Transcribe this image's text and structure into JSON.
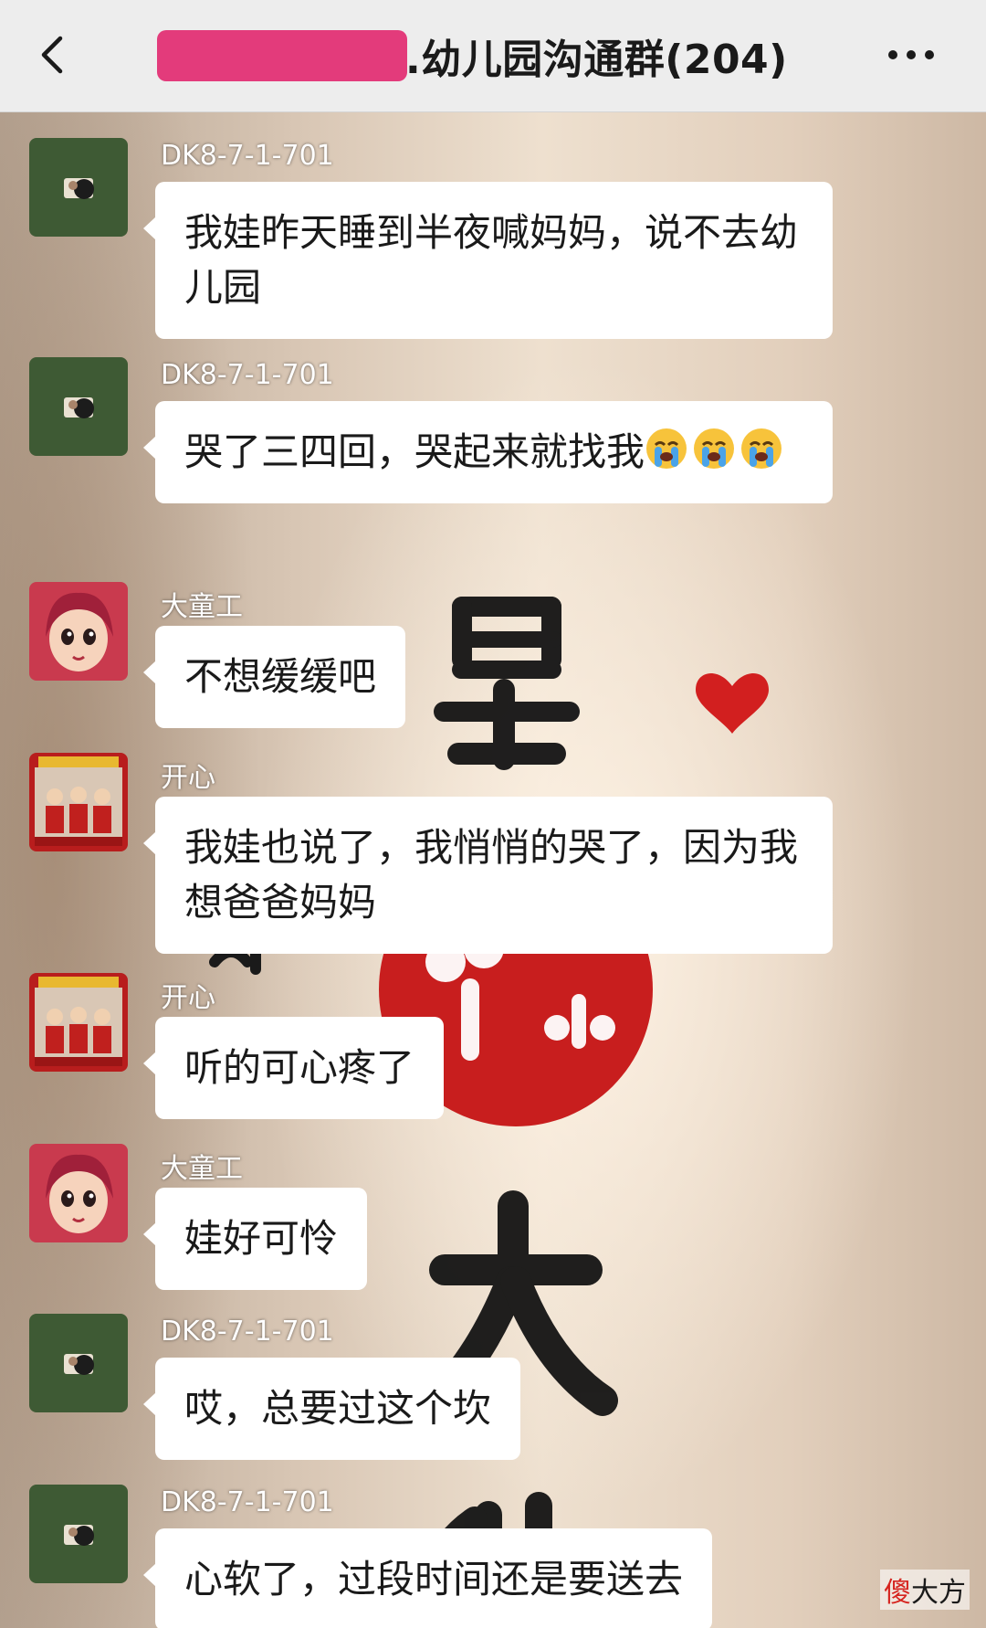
{
  "header": {
    "title": ".幼儿园沟通群(204)",
    "redaction_color": "#e33b7b"
  },
  "messages": [
    {
      "sender": "DK8-7-1-701",
      "avatar_icon": "photo-avatar-icon",
      "text": "我娃昨天睡到半夜喊妈妈，说不去幼儿园"
    },
    {
      "sender": "DK8-7-1-701",
      "avatar_icon": "photo-avatar-icon",
      "text": "哭了三四回，哭起来就找我",
      "emojis": [
        "crying-face-emoji",
        "crying-face-emoji",
        "crying-face-emoji"
      ]
    },
    {
      "sender": "大童工",
      "avatar_icon": "cartoon-girl-avatar-icon",
      "text": "不想缓缓吧"
    },
    {
      "sender": "开心",
      "avatar_icon": "new-year-photo-avatar-icon",
      "text": "我娃也说了，我悄悄的哭了，因为我想爸爸妈妈"
    },
    {
      "sender": "开心",
      "avatar_icon": "new-year-photo-avatar-icon",
      "text": "听的可心疼了"
    },
    {
      "sender": "大童工",
      "avatar_icon": "cartoon-girl-avatar-icon",
      "text": "娃好可怜"
    },
    {
      "sender": "DK8-7-1-701",
      "avatar_icon": "photo-avatar-icon",
      "text": "哎，总要过这个坎"
    },
    {
      "sender": "DK8-7-1-701",
      "avatar_icon": "photo-avatar-icon",
      "text": "心软了，过段时间还是要送去"
    }
  ],
  "watermark": {
    "first_char": "傻",
    "rest": "大方"
  },
  "colors": {
    "header_bg": "#ededed",
    "bubble_bg": "#ffffff",
    "sender_name": "#ffffff",
    "avatar_green": "#3e5a34"
  }
}
